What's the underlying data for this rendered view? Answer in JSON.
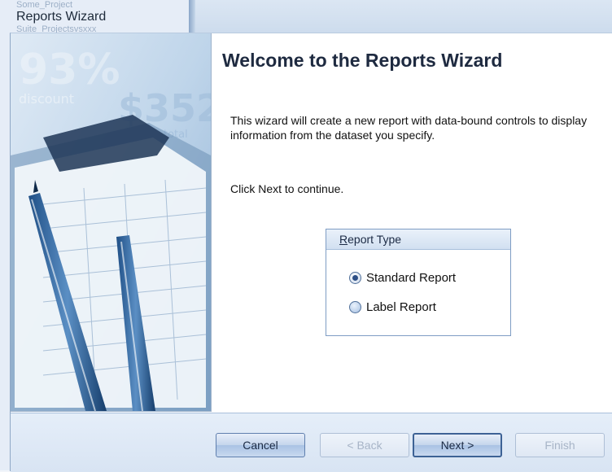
{
  "background": {
    "caption": "Reports Wizard",
    "faded_line_1": "Some_Project",
    "faded_line_2": "Suite_Projectsvsxxx"
  },
  "wizard": {
    "title": "Welcome to the Reports Wizard",
    "description": "This wizard will create a new report with data-bound controls to display information from the dataset you specify.",
    "continue_hint": "Click Next to continue.",
    "report_type": {
      "legend_first_letter": "R",
      "legend_rest": "eport Type",
      "options": [
        {
          "label": "Standard Report",
          "selected": true
        },
        {
          "label": "Label Report",
          "selected": false
        }
      ]
    },
    "buttons": {
      "cancel": "Cancel",
      "back": "< Back",
      "next": "Next >",
      "finish": "Finish"
    },
    "image_text": {
      "percent": "93%",
      "discount": "discount",
      "price": "$352",
      "total": "total"
    }
  },
  "colors": {
    "accent": "#3d6295",
    "image_base": "#cfe0f0",
    "button_border": "#5f7fae"
  }
}
